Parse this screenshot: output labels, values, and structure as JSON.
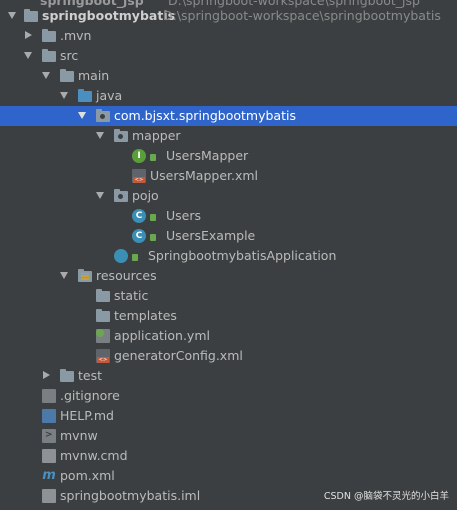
{
  "partial_top_row": {
    "project": "springboot_jsp",
    "path": "D:\\springboot-workspace\\springboot_jsp"
  },
  "tree": [
    {
      "label": "springbootmybatis",
      "path": "D:\\springboot-workspace\\springbootmybatis",
      "icon": "project-folder-icon",
      "expanded": true
    },
    {
      "label": ".mvn",
      "icon": "folder-icon",
      "expanded": false
    },
    {
      "label": "src",
      "icon": "folder-icon",
      "expanded": true
    },
    {
      "label": "main",
      "icon": "folder-icon",
      "expanded": true
    },
    {
      "label": "java",
      "icon": "source-folder-icon",
      "expanded": true
    },
    {
      "label": "com.bjsxt.springbootmybatis",
      "icon": "package-icon",
      "expanded": true,
      "selected": true
    },
    {
      "label": "mapper",
      "icon": "package-icon",
      "expanded": true
    },
    {
      "label": "UsersMapper",
      "icon": "interface-icon",
      "badge": "I"
    },
    {
      "label": "UsersMapper.xml",
      "icon": "xml-file-icon"
    },
    {
      "label": "pojo",
      "icon": "package-icon",
      "expanded": true
    },
    {
      "label": "Users",
      "icon": "class-icon",
      "badge": "C"
    },
    {
      "label": "UsersExample",
      "icon": "class-icon",
      "badge": "C"
    },
    {
      "label": "SpringbootmybatisApplication",
      "icon": "spring-boot-class-icon"
    },
    {
      "label": "resources",
      "icon": "resources-folder-icon",
      "expanded": true
    },
    {
      "label": "static",
      "icon": "folder-icon"
    },
    {
      "label": "templates",
      "icon": "folder-icon"
    },
    {
      "label": "application.yml",
      "icon": "yml-file-icon"
    },
    {
      "label": "generatorConfig.xml",
      "icon": "xml-file-icon"
    },
    {
      "label": "test",
      "icon": "folder-icon",
      "expanded": false
    },
    {
      "label": ".gitignore",
      "icon": "gitignore-file-icon"
    },
    {
      "label": "HELP.md",
      "icon": "markdown-file-icon"
    },
    {
      "label": "mvnw",
      "icon": "script-file-icon"
    },
    {
      "label": "mvnw.cmd",
      "icon": "text-file-icon"
    },
    {
      "label": "pom.xml",
      "icon": "maven-file-icon"
    },
    {
      "label": "springbootmybatis.iml",
      "icon": "iml-file-icon"
    }
  ],
  "watermark": "CSDN @脑袋不灵光的小白羊",
  "colors": {
    "background": "#3c3f41",
    "selection": "#2f65ca",
    "text": "#bbbbbb",
    "source_folder": "#4b8fc1",
    "interface_badge": "#5a9e3c",
    "class_badge": "#3b8fb4"
  }
}
